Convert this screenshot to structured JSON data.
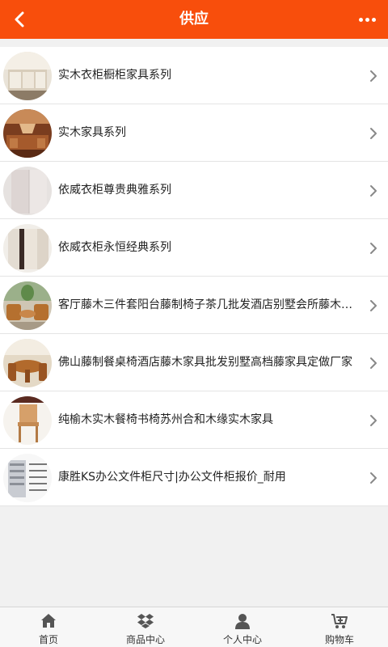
{
  "header": {
    "title": "供应",
    "back_icon": "chevron-left-icon",
    "more_icon": "more-dots-icon",
    "color": "#f84e0c"
  },
  "items": [
    {
      "label": "实木衣柜橱柜家具系列"
    },
    {
      "label": "实木家具系列"
    },
    {
      "label": "依威衣柜尊贵典雅系列"
    },
    {
      "label": "依威衣柜永恒经典系列"
    },
    {
      "label": "客厅藤木三件套阳台藤制椅子茶几批发酒店别墅会所藤木家具"
    },
    {
      "label": "佛山藤制餐桌椅酒店藤木家具批发别墅高档藤家具定做厂家"
    },
    {
      "label": "纯榆木实木餐椅书椅苏州合和木缘实木家具"
    },
    {
      "label": "康胜KS办公文件柜尺寸|办公文件柜报价_耐用"
    }
  ],
  "tabbar": [
    {
      "label": "首页",
      "icon": "home-icon"
    },
    {
      "label": "商品中心",
      "icon": "dropbox-icon"
    },
    {
      "label": "个人中心",
      "icon": "user-icon"
    },
    {
      "label": "购物车",
      "icon": "cart-icon"
    }
  ]
}
